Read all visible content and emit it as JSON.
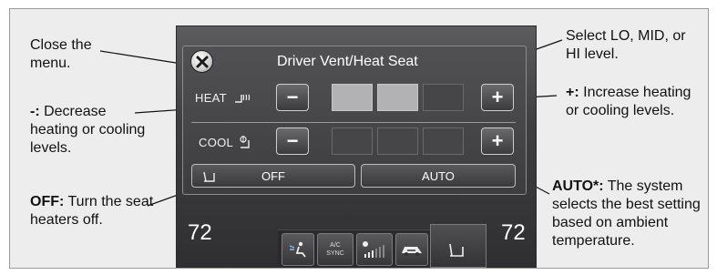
{
  "annotations": {
    "close": "Close the menu.",
    "decrease_key": "-:",
    "decrease_text": " Decrease heating or cooling levels.",
    "off_key": "OFF:",
    "off_text": " Turn the seat heaters off.",
    "select_level": "Select LO, MID, or HI level.",
    "increase_key": "+:",
    "increase_text": " Increase heating or cooling levels.",
    "auto_key": "AUTO*:",
    "auto_text": " The system selects the best setting based on ambient temperature."
  },
  "popup": {
    "title": "Driver Vent/Heat Seat",
    "heat_label": "HEAT",
    "cool_label": "COOL",
    "minus": "−",
    "plus": "+",
    "heat_level": 2,
    "cool_level": 0,
    "off_label": "OFF",
    "auto_label": "AUTO"
  },
  "climate_bar": {
    "left_temp": "72",
    "right_temp": "72",
    "ac_label": "A/C",
    "sync_label": "SYNC"
  },
  "icons": [
    "close-icon",
    "seat-heat-icon",
    "seat-cool-icon",
    "seat-icon",
    "airflow-icon",
    "fan-icon",
    "recirculation-icon"
  ],
  "colors": {
    "segment_on": "#b2b2b4",
    "segment_off": "#464648",
    "screen_bg": "#3d3d3f"
  }
}
